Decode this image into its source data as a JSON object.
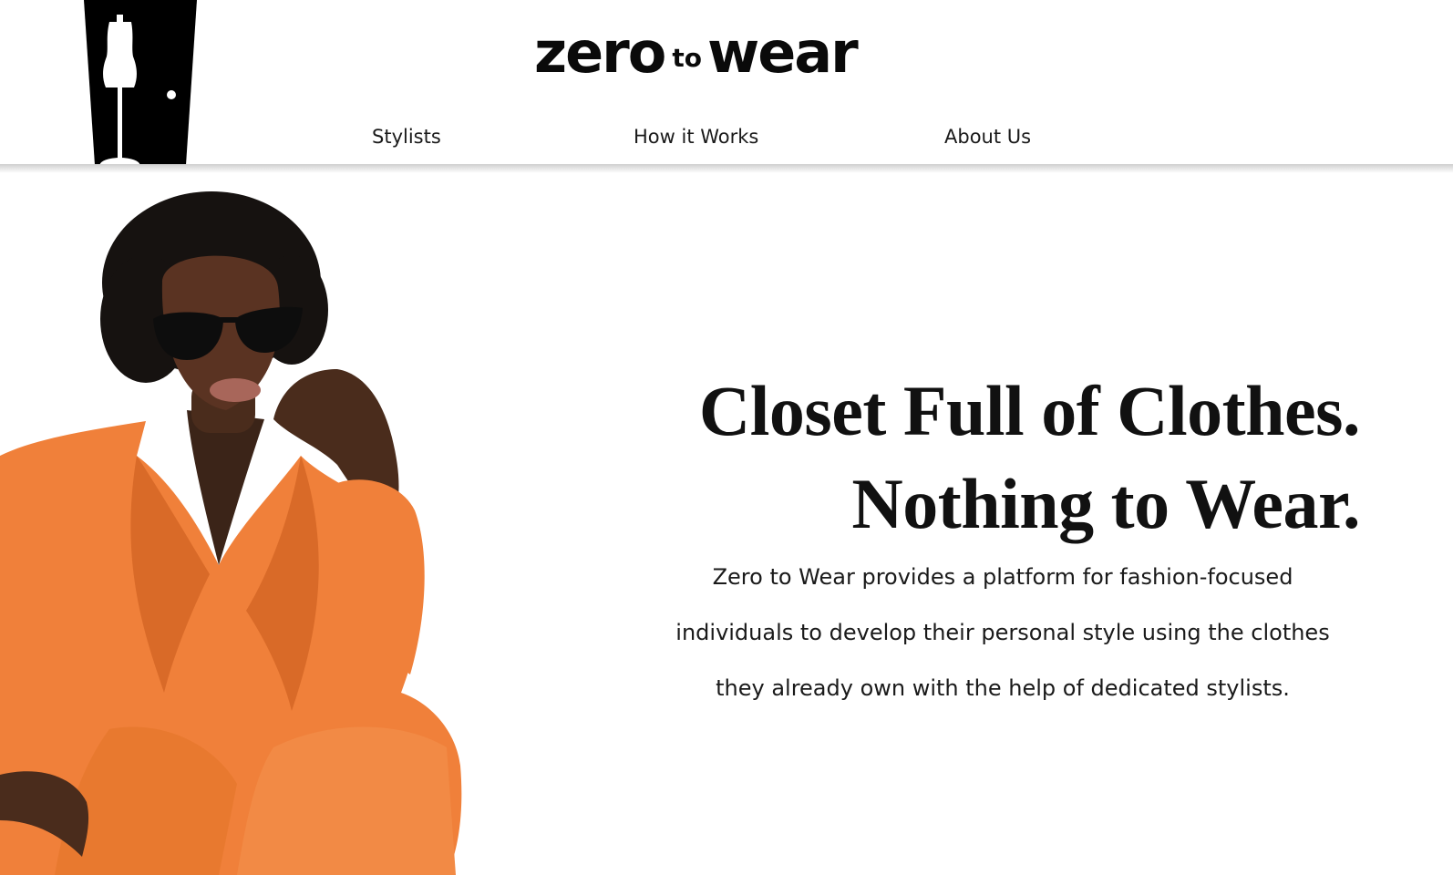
{
  "brand": {
    "name_part1": "zero",
    "name_part2": "to",
    "name_part3": "wear",
    "logo_icon": "dress-form-door-icon"
  },
  "nav": {
    "items": [
      {
        "label": "Stylists"
      },
      {
        "label": "How it Works"
      },
      {
        "label": "About Us"
      }
    ]
  },
  "hero": {
    "headline_line1": "Closet Full of Clothes.",
    "headline_line2": "Nothing to Wear.",
    "description_line1": "Zero to Wear provides a platform for fashion-focused",
    "description_line2": "individuals to develop their personal style using the clothes",
    "description_line3": "they already own with the help of dedicated stylists.",
    "image": "model-in-orange-suit-with-sunglasses"
  },
  "colors": {
    "background": "#ffffff",
    "text": "#111111",
    "logo": "#000000",
    "suit_orange": "#f0803a",
    "header_shadow": "#cfcfcf"
  }
}
